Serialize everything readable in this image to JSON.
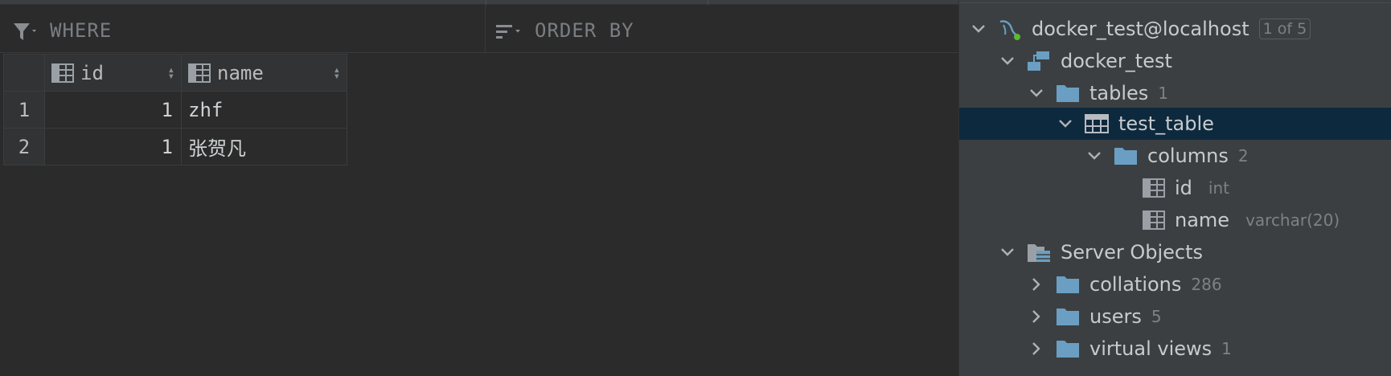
{
  "filter": {
    "where_label": "WHERE",
    "orderby_label": "ORDER BY"
  },
  "grid": {
    "columns": [
      {
        "label": "id"
      },
      {
        "label": "name"
      }
    ],
    "rows": [
      {
        "num": "1",
        "id": "1",
        "name": "zhf"
      },
      {
        "num": "2",
        "id": "1",
        "name": "张贺凡"
      }
    ]
  },
  "tree": {
    "connection": {
      "label": "docker_test@localhost",
      "badge": "1 of 5"
    },
    "schema": {
      "label": "docker_test"
    },
    "tables": {
      "label": "tables",
      "count": "1"
    },
    "table": {
      "label": "test_table"
    },
    "columns": {
      "label": "columns",
      "count": "2"
    },
    "col_id": {
      "label": "id",
      "type": "int"
    },
    "col_name": {
      "label": "name",
      "type": "varchar(20)"
    },
    "server_objects": {
      "label": "Server Objects"
    },
    "collations": {
      "label": "collations",
      "count": "286"
    },
    "users": {
      "label": "users",
      "count": "5"
    },
    "virtual_views": {
      "label": "virtual views",
      "count": "1"
    }
  },
  "colors": {
    "background": "#2b2b2b",
    "panel": "#3c3f41",
    "selection": "#0d293e",
    "folder": "#6a9fc3"
  }
}
